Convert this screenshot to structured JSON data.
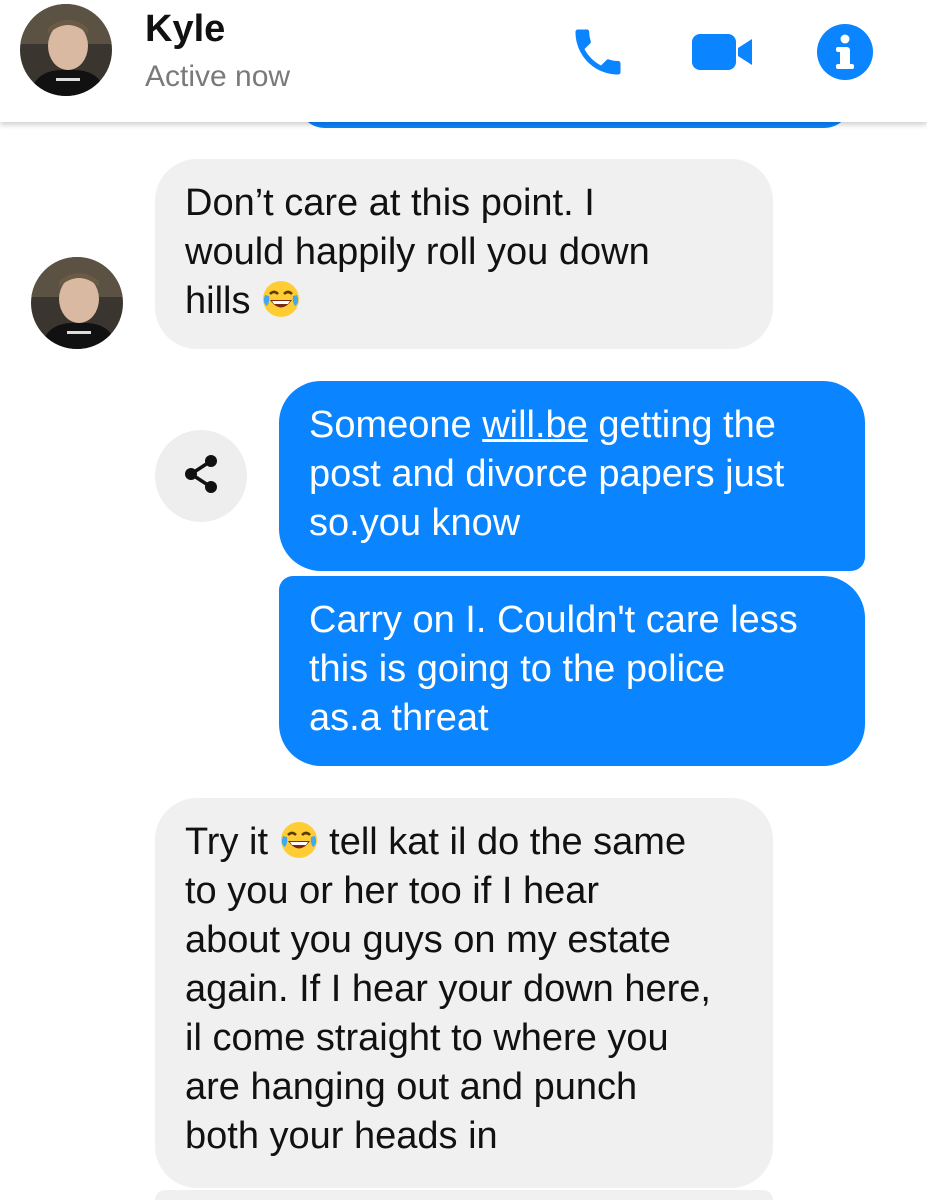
{
  "header": {
    "name": "Kyle",
    "status": "Active now",
    "icons": [
      "phone-icon",
      "video-camera-icon",
      "info-icon"
    ],
    "accent_color": "#0a84ff"
  },
  "messages": [
    {
      "direction": "incoming",
      "lines": [
        "Don’t care at this point. I",
        "would happily roll you down",
        "hills"
      ],
      "emoji": "face-with-tears-of-joy"
    },
    {
      "direction": "outgoing",
      "lines": [
        "getting the",
        "post and divorce papers just",
        "so.you know"
      ],
      "prefix": "Someone",
      "link": "will.be"
    },
    {
      "direction": "outgoing",
      "lines": [
        "Carry on I. Couldn't care less",
        "this is going to the police",
        "as.a threat"
      ]
    },
    {
      "direction": "incoming",
      "first_pre": "Try it",
      "first_post": "tell kat il do the same",
      "lines": [
        "to you or her too if I hear",
        "about you guys on my estate",
        "again. If I hear your down here,",
        "il come straight to where you",
        "are hanging out and punch",
        "both your heads in"
      ],
      "emoji": "face-with-tears-of-joy"
    }
  ],
  "colors": {
    "incoming_bubble": "#f0f0f0",
    "outgoing_bubble": "#0a84ff"
  }
}
